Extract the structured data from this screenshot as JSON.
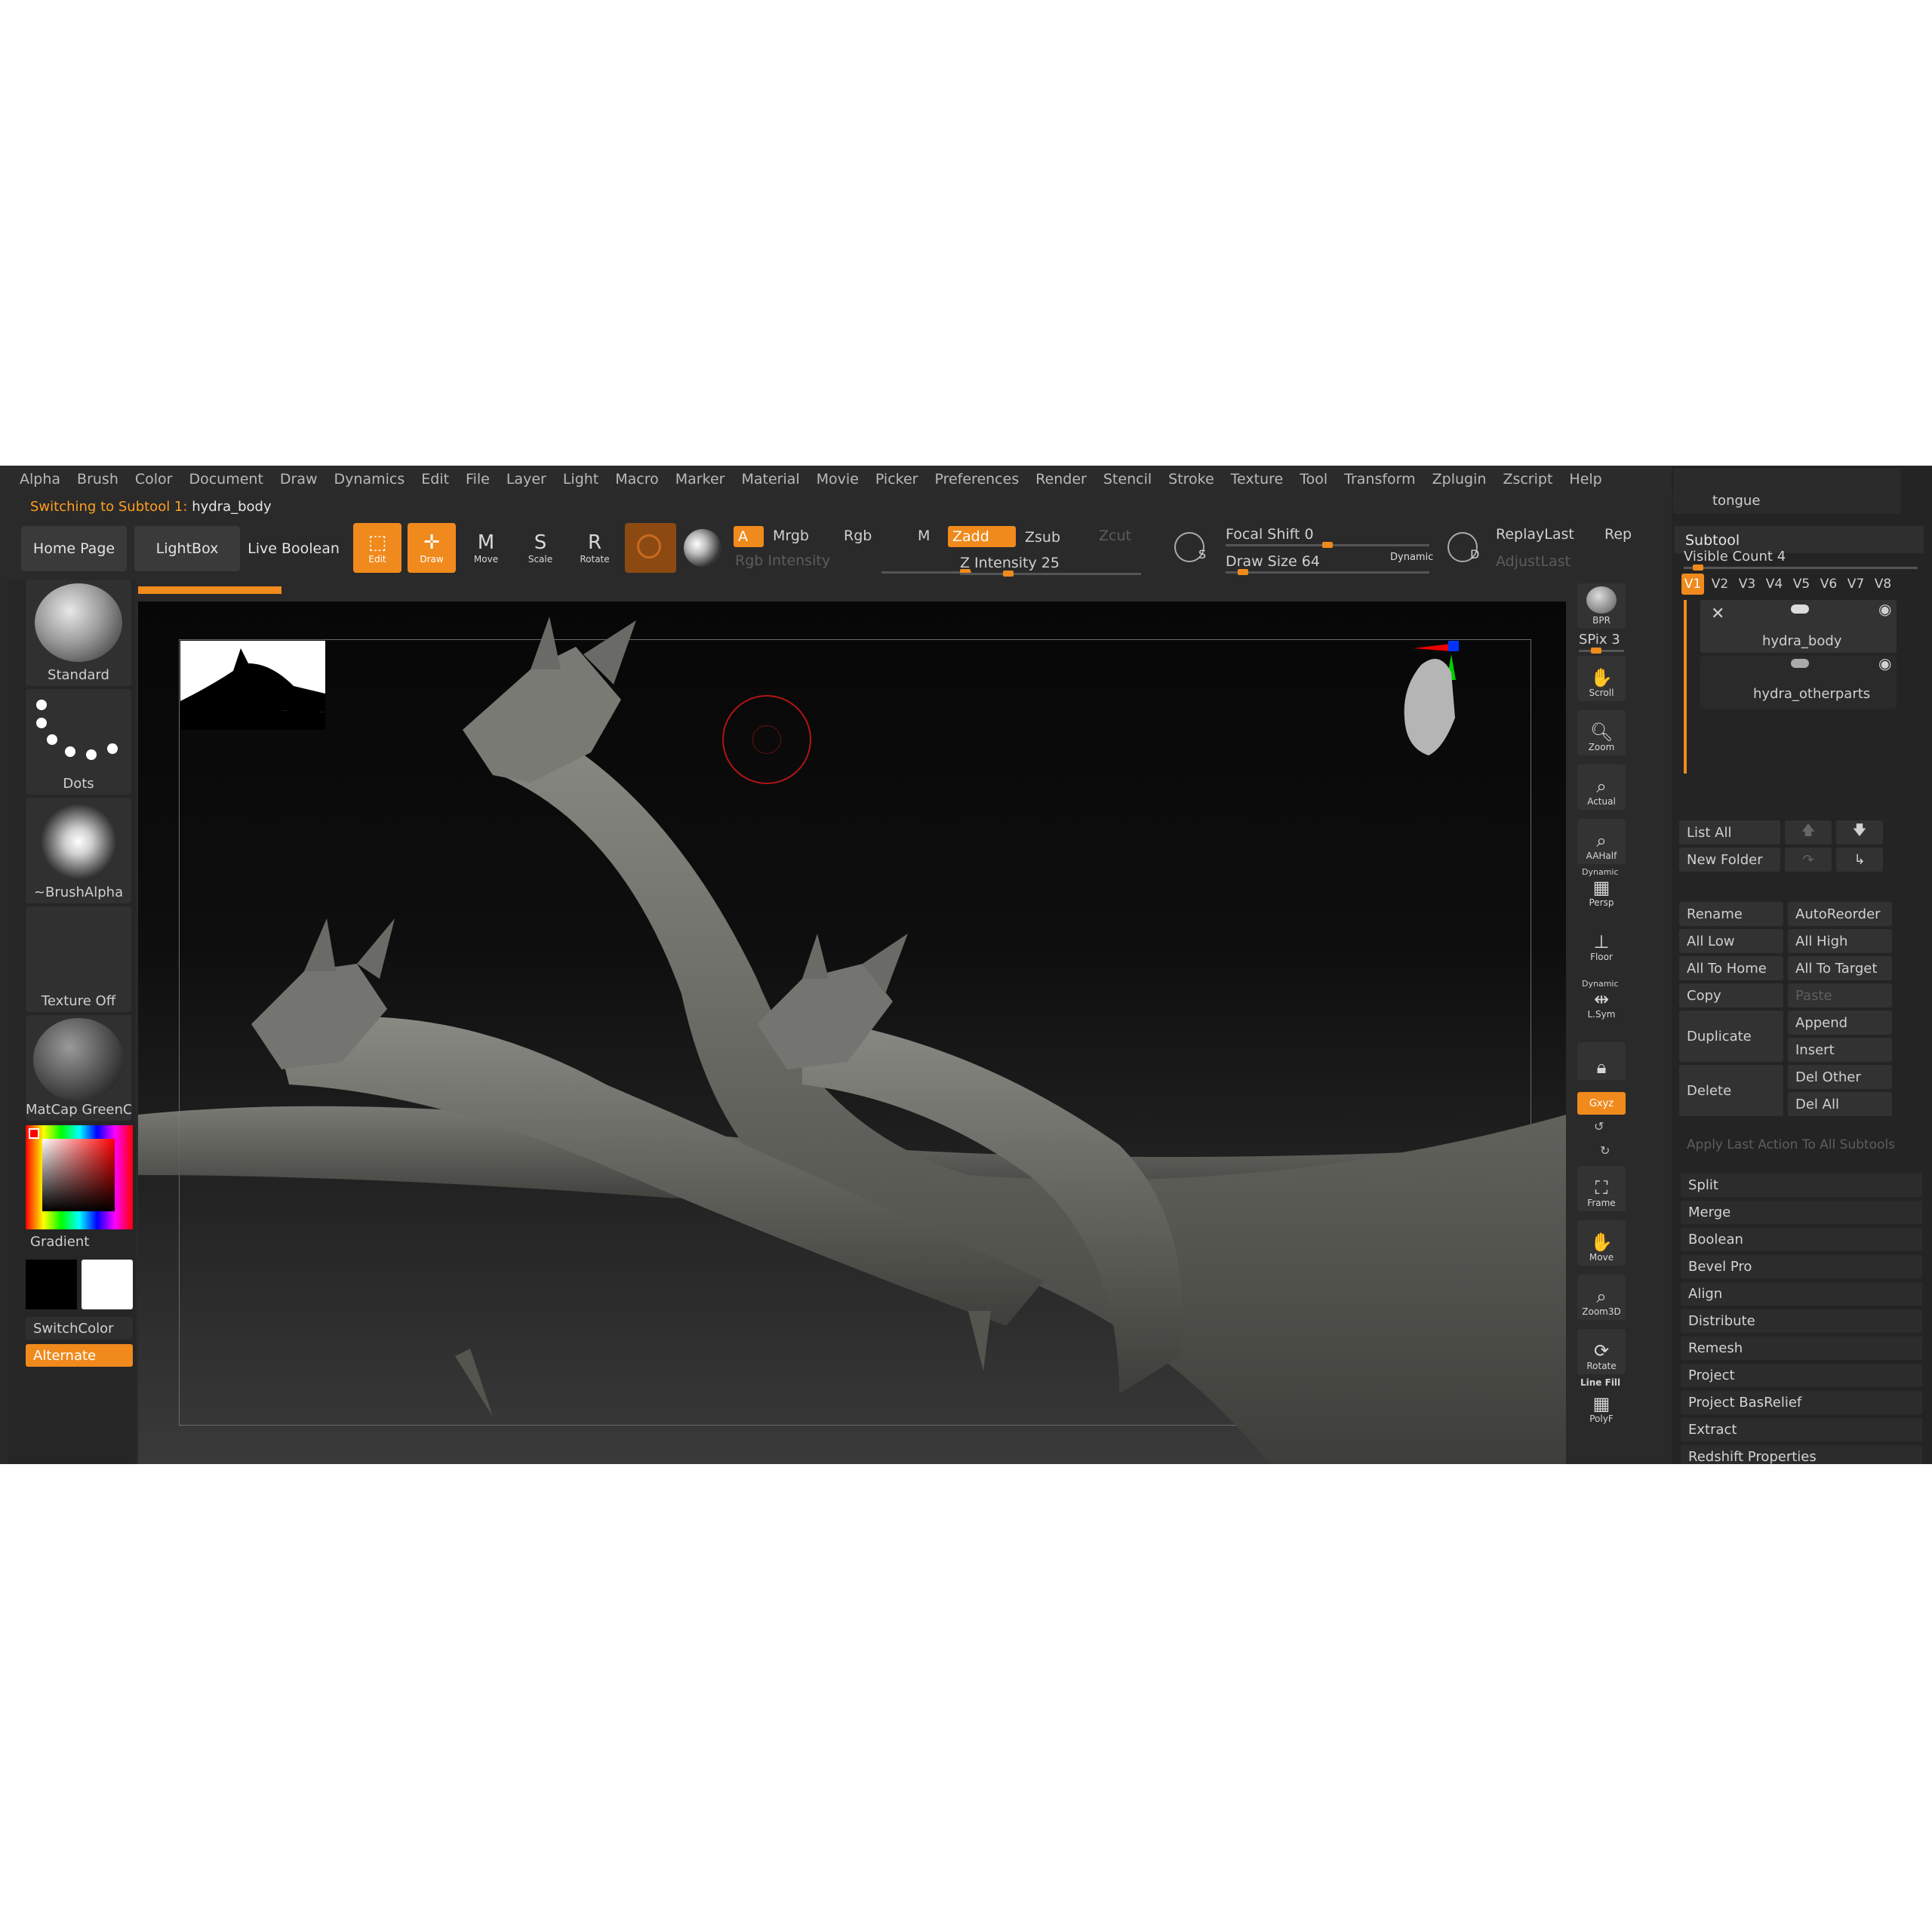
{
  "menu": [
    "Alpha",
    "Brush",
    "Color",
    "Document",
    "Draw",
    "Dynamics",
    "Edit",
    "File",
    "Layer",
    "Light",
    "Macro",
    "Marker",
    "Material",
    "Movie",
    "Picker",
    "Preferences",
    "Render",
    "Stencil",
    "Stroke",
    "Texture",
    "Tool",
    "Transform",
    "Zplugin",
    "Zscript",
    "Help"
  ],
  "notice": {
    "prefix": "Switching to Subtool 1:",
    "name": "hydra_body"
  },
  "toolbar": {
    "home_page": "Home Page",
    "lightbox": "LightBox",
    "live_boolean": "Live Boolean",
    "edit": "Edit",
    "draw": "Draw",
    "move": "Move",
    "scale": "Scale",
    "rotate": "Rotate",
    "a": "A",
    "mrgb": "Mrgb",
    "rgb": "Rgb",
    "m": "M",
    "rgb_intensity": "Rgb Intensity",
    "zadd": "Zadd",
    "zsub": "Zsub",
    "zcut": "Zcut",
    "z_intensity": "Z Intensity 25",
    "z_intensity_value": 25,
    "focal_shift": "Focal Shift 0",
    "focal_shift_value": 0,
    "draw_size": "Draw Size 64",
    "draw_size_value": 64,
    "dynamic": "Dynamic",
    "replay_last": "ReplayLast",
    "rep": "Rep",
    "adjust_last": "AdjustLast",
    "s_glyph": "S",
    "d_glyph": "D"
  },
  "left": {
    "standard": "Standard",
    "dots": "Dots",
    "brush_alpha": "~BrushAlpha",
    "texture_off": "Texture Off",
    "matcap": "MatCap GreenCl",
    "gradient": "Gradient",
    "switch_color": "SwitchColor",
    "alternate": "Alternate"
  },
  "right_strip": {
    "bpr": "BPR",
    "spix": "SPix 3",
    "scroll": "Scroll",
    "zoom": "Zoom",
    "actual": "Actual",
    "aahalf": "AAHalf",
    "dynamic1": "Dynamic",
    "persp": "Persp",
    "floor": "Floor",
    "dynamic2": "Dynamic",
    "lsym": "L.Sym",
    "xyz": "Gxyz",
    "frame": "Frame",
    "move": "Move",
    "zoom3d": "Zoom3D",
    "rotate": "Rotate",
    "line_fill": "Line Fill",
    "polyf": "PolyF"
  },
  "subtool": {
    "top_label": "tongue",
    "title": "Subtool",
    "visible_count": "Visible Count 4",
    "visible_count_value": 4,
    "tabs": [
      "V1",
      "V2",
      "V3",
      "V4",
      "V5",
      "V6",
      "V7",
      "V8"
    ],
    "items": [
      "hydra_body",
      "hydra_otherparts"
    ],
    "list_all": "List All",
    "new_folder": "New Folder",
    "rename": "Rename",
    "auto_reorder": "AutoReorder",
    "all_low": "All Low",
    "all_high": "All High",
    "all_to_home": "All To Home",
    "all_to_target": "All To Target",
    "copy": "Copy",
    "paste": "Paste",
    "duplicate": "Duplicate",
    "append": "Append",
    "insert": "Insert",
    "delete": "Delete",
    "del_other": "Del Other",
    "del_all": "Del All",
    "apply_last": "Apply Last Action To All Subtools",
    "sections": [
      "Split",
      "Merge",
      "Boolean",
      "Bevel Pro",
      "Align",
      "Distribute",
      "Remesh",
      "Project",
      "Project BasRelief",
      "Extract",
      "Redshift Properties"
    ]
  },
  "colors": {
    "accent": "#f08a1c",
    "panel": "#2a2a2a",
    "viewport": "#0b0b0b"
  }
}
